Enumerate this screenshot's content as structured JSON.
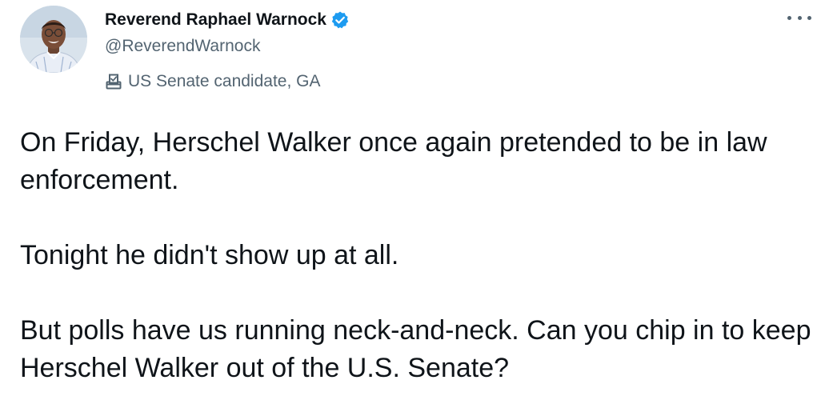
{
  "author": {
    "display_name": "Reverend Raphael Warnock",
    "handle": "@ReverendWarnock",
    "verified_icon": "verified-badge-icon",
    "label": "US Senate candidate, GA",
    "label_icon": "ballot-box-icon"
  },
  "menu": {
    "more_icon": "more-options-icon"
  },
  "tweet": {
    "paragraph_1": "On Friday, Herschel Walker once again pretended to be in law enforcement.",
    "paragraph_2": "Tonight he didn't show up at all.",
    "paragraph_3": "But polls have us running neck-and-neck. Can you chip in to keep Herschel Walker out of the U.S. Senate?"
  },
  "colors": {
    "text_primary": "#0f1419",
    "text_secondary": "#536471",
    "verified_blue": "#1d9bf0"
  }
}
